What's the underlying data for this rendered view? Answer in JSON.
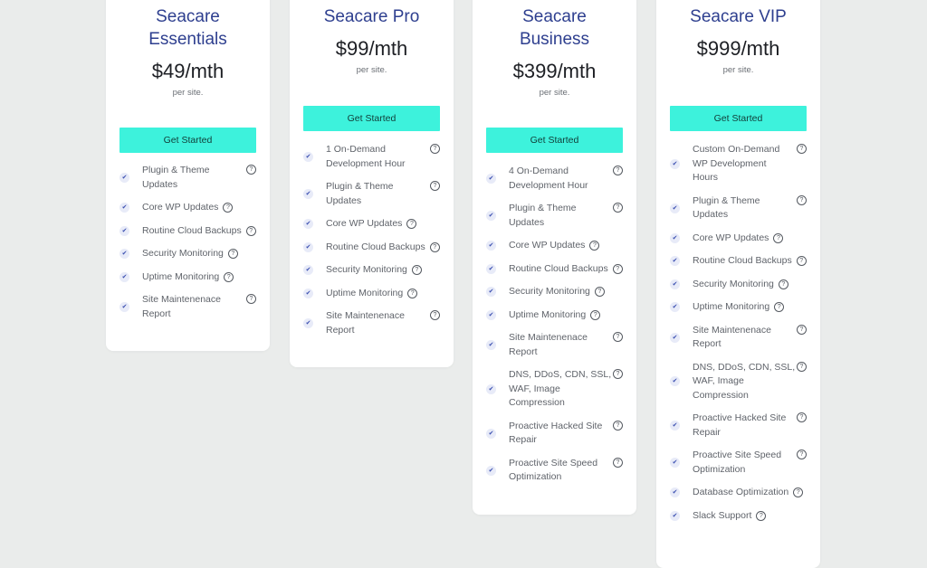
{
  "plans": [
    {
      "name_lines": [
        "Seacare",
        "Essentials"
      ],
      "price": "$49/mth",
      "per": "per site.",
      "cta": "Get Started",
      "features": [
        {
          "lines": [
            "Plugin & Theme",
            "Updates"
          ]
        },
        {
          "lines": [
            "Core WP Updates"
          ]
        },
        {
          "lines": [
            "Routine Cloud Backups"
          ]
        },
        {
          "lines": [
            "Security Monitoring"
          ]
        },
        {
          "lines": [
            "Uptime Monitoring"
          ]
        },
        {
          "lines": [
            "Site Maintenenace",
            "Report"
          ]
        }
      ]
    },
    {
      "name_lines": [
        "Seacare Pro"
      ],
      "price": "$99/mth",
      "per": "per site.",
      "cta": "Get Started",
      "features": [
        {
          "lines": [
            "1 On-Demand",
            "Development Hour"
          ]
        },
        {
          "lines": [
            "Plugin & Theme",
            "Updates"
          ]
        },
        {
          "lines": [
            "Core WP Updates"
          ]
        },
        {
          "lines": [
            "Routine Cloud Backups"
          ]
        },
        {
          "lines": [
            "Security Monitoring"
          ]
        },
        {
          "lines": [
            "Uptime Monitoring"
          ]
        },
        {
          "lines": [
            "Site Maintenenace",
            "Report"
          ]
        }
      ]
    },
    {
      "name_lines": [
        "Seacare",
        "Business"
      ],
      "price": "$399/mth",
      "per": "per site.",
      "cta": "Get Started",
      "features": [
        {
          "lines": [
            "4 On-Demand",
            "Development Hour"
          ]
        },
        {
          "lines": [
            "Plugin & Theme",
            "Updates"
          ]
        },
        {
          "lines": [
            "Core WP Updates"
          ]
        },
        {
          "lines": [
            "Routine Cloud Backups"
          ]
        },
        {
          "lines": [
            "Security Monitoring"
          ]
        },
        {
          "lines": [
            "Uptime Monitoring"
          ]
        },
        {
          "lines": [
            "Site Maintenenace",
            "Report"
          ]
        },
        {
          "lines": [
            "DNS, DDoS, CDN, SSL,",
            "WAF, Image",
            "Compression"
          ]
        },
        {
          "lines": [
            "Proactive Hacked Site",
            "Repair"
          ]
        },
        {
          "lines": [
            "Proactive Site Speed",
            "Optimization"
          ]
        }
      ]
    },
    {
      "name_lines": [
        "Seacare VIP"
      ],
      "price": "$999/mth",
      "per": "per site.",
      "cta": "Get Started",
      "features": [
        {
          "lines": [
            "Custom On-Demand",
            "WP Development",
            "Hours"
          ]
        },
        {
          "lines": [
            "Plugin & Theme",
            "Updates"
          ]
        },
        {
          "lines": [
            "Core WP Updates"
          ]
        },
        {
          "lines": [
            "Routine Cloud Backups"
          ]
        },
        {
          "lines": [
            "Security Monitoring"
          ]
        },
        {
          "lines": [
            "Uptime Monitoring"
          ]
        },
        {
          "lines": [
            "Site Maintenenace",
            "Report"
          ]
        },
        {
          "lines": [
            "DNS, DDoS, CDN, SSL,",
            "WAF, Image",
            "Compression"
          ]
        },
        {
          "lines": [
            "Proactive Hacked Site",
            "Repair"
          ]
        },
        {
          "lines": [
            "Proactive Site Speed",
            "Optimization"
          ]
        },
        {
          "lines": [
            "Database Optimization"
          ]
        },
        {
          "lines": [
            "Slack Support"
          ]
        }
      ]
    }
  ],
  "icons": {
    "check": "check-icon",
    "help": "help-circle-icon"
  },
  "colors": {
    "accent": "#3df2dc",
    "title": "#2e3f8f",
    "background": "#eaeceb"
  }
}
